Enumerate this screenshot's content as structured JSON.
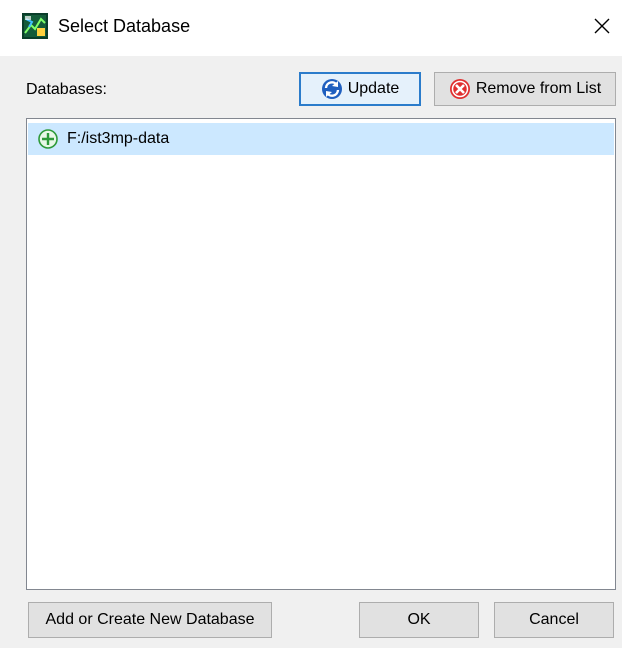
{
  "window": {
    "title": "Select Database",
    "close_glyph": "✕",
    "app_icon": "database-app-icon"
  },
  "databases_section": {
    "label": "Databases:",
    "update_button": {
      "label": "Update",
      "icon": "refresh-icon",
      "focused": true
    },
    "remove_button": {
      "label": "Remove from List",
      "icon": "remove-icon"
    },
    "items": [
      {
        "label": "F:/ist3mp-data",
        "icon": "add-circle-icon",
        "selected": true
      }
    ]
  },
  "footer": {
    "add_button": "Add or Create New Database",
    "ok_button": "OK",
    "cancel_button": "Cancel"
  },
  "colors": {
    "selection": "#cce8ff",
    "focus_border": "#2b7ccb",
    "button_face": "#e1e1e1",
    "dialog_body": "#f0f0f0"
  }
}
